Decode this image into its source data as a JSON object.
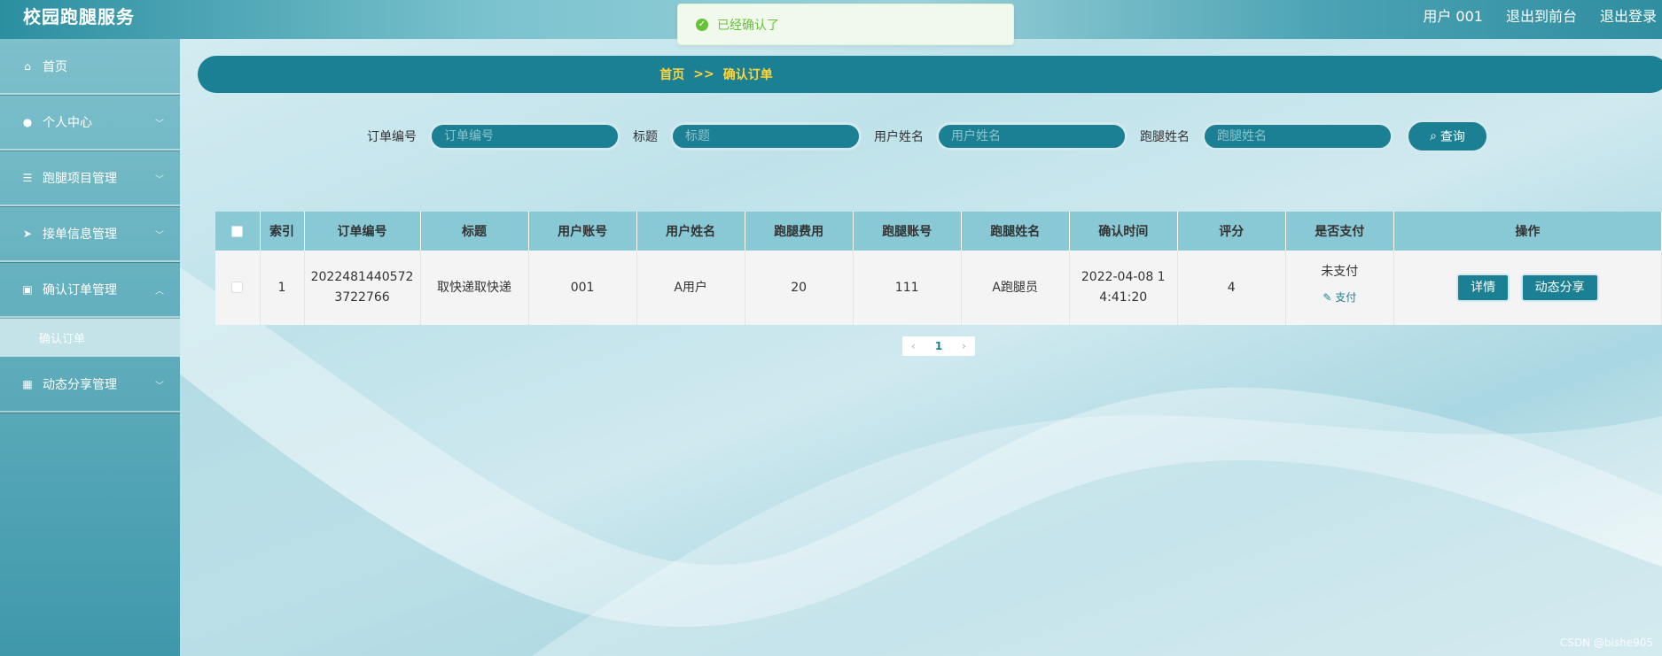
{
  "header": {
    "app_title": "校园跑腿服务",
    "user_label": "用户 001",
    "exit_front_label": "退出到前台",
    "logout_label": "退出登录"
  },
  "toast": {
    "message": "已经确认了",
    "icon": "check-circle-icon",
    "color": "#67c23a"
  },
  "sidebar": {
    "items": [
      {
        "label": "首页",
        "icon": "home-icon"
      },
      {
        "label": "个人中心",
        "icon": "user-icon"
      },
      {
        "label": "跑腿项目管理",
        "icon": "list-icon"
      },
      {
        "label": "接单信息管理",
        "icon": "send-icon"
      },
      {
        "label": "确认订单管理",
        "icon": "chart-icon"
      },
      {
        "label": "动态分享管理",
        "icon": "grid-icon"
      }
    ],
    "submenu_label": "确认订单"
  },
  "breadcrumb": {
    "home": "首页",
    "separator": ">>",
    "current": "确认订单"
  },
  "search": {
    "fields": [
      {
        "label": "订单编号",
        "placeholder": "订单编号"
      },
      {
        "label": "标题",
        "placeholder": "标题"
      },
      {
        "label": "用户姓名",
        "placeholder": "用户姓名"
      },
      {
        "label": "跑腿姓名",
        "placeholder": "跑腿姓名"
      }
    ],
    "button_label": "查询"
  },
  "table": {
    "columns": [
      "索引",
      "订单编号",
      "标题",
      "用户账号",
      "用户姓名",
      "跑腿费用",
      "跑腿账号",
      "跑腿姓名",
      "确认时间",
      "评分",
      "是否支付",
      "操作"
    ],
    "rows": [
      {
        "index": "1",
        "order_no_line1": "2022481440572",
        "order_no_line2": "3722766",
        "title": "取快递取快递",
        "user_account": "001",
        "user_name": "A用户",
        "fee": "20",
        "runner_account": "111",
        "runner_name": "A跑腿员",
        "confirm_time_line1": "2022-04-08 1",
        "confirm_time_line2": "4:41:20",
        "rating": "4",
        "pay_status": "未支付",
        "pay_action": "支付",
        "detail_btn": "详情",
        "share_btn": "动态分享"
      }
    ]
  },
  "pagination": {
    "current_page": "1"
  },
  "watermark": "CSDN @bishe905",
  "colors": {
    "primary": "#1b8093",
    "breadcrumb_text": "#ffd43b",
    "table_header": "#88c9d5"
  }
}
